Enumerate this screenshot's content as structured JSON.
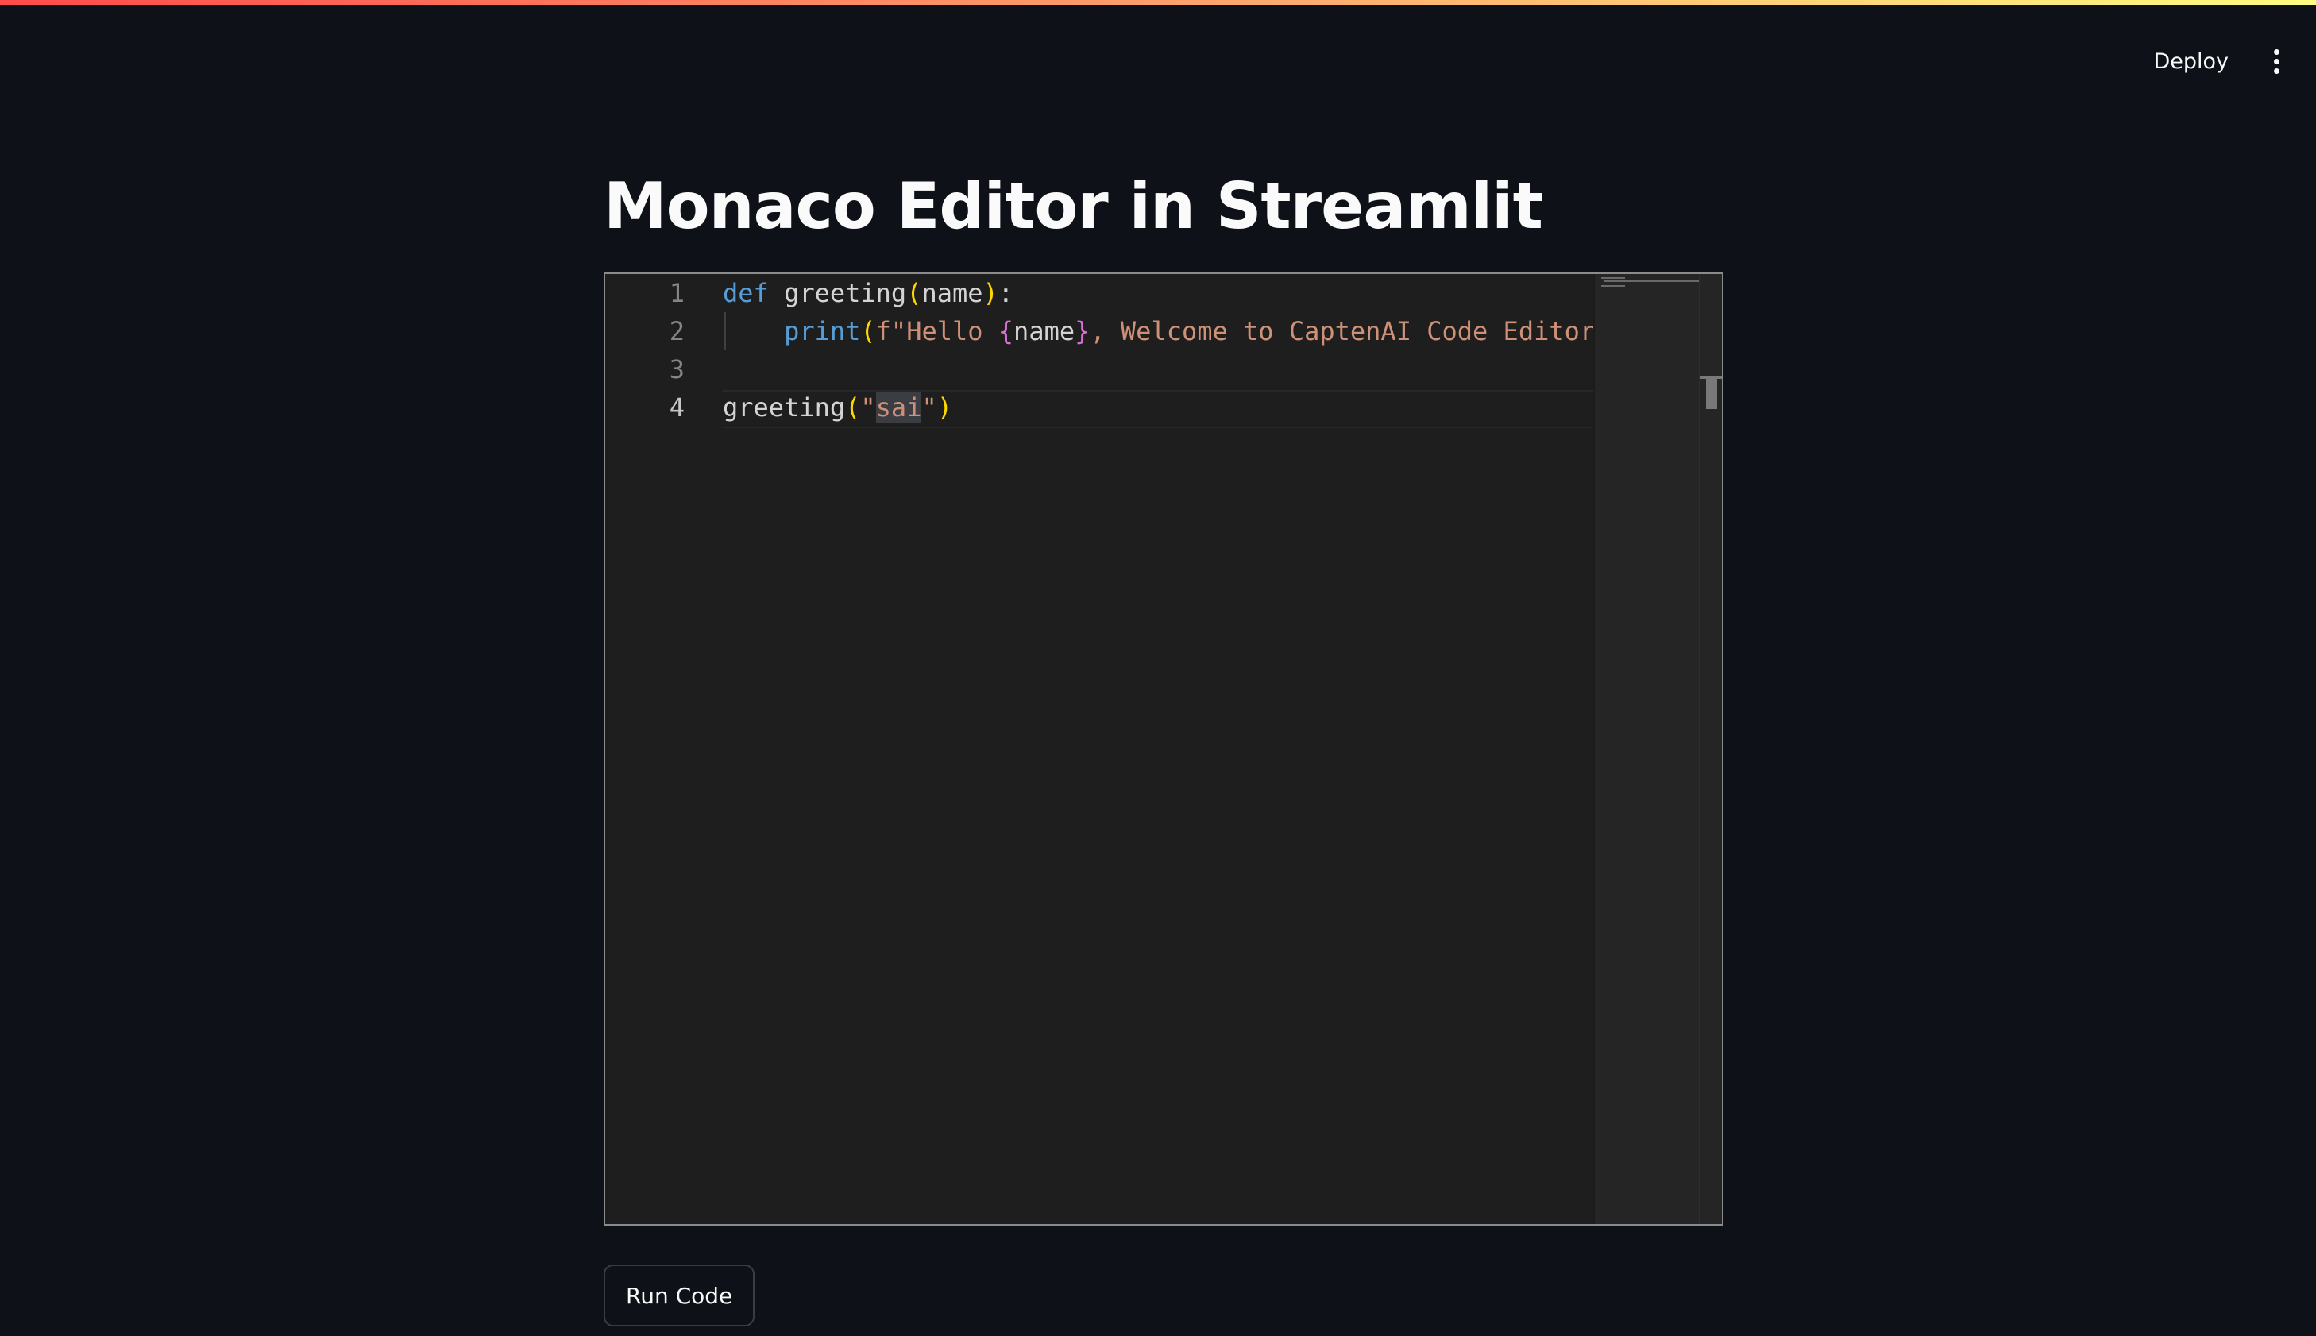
{
  "header": {
    "deploy_label": "Deploy",
    "menu_icon": "vertical-ellipsis-icon"
  },
  "main": {
    "title": "Monaco Editor in Streamlit",
    "run_button_label": "Run Code"
  },
  "editor": {
    "line_numbers": [
      "1",
      "2",
      "3",
      "4"
    ],
    "active_line": "4",
    "lines": [
      {
        "tokens": [
          {
            "text": "def",
            "kind": "kw"
          },
          {
            "text": " greeting",
            "kind": "id"
          },
          {
            "text": "(",
            "kind": "br1"
          },
          {
            "text": "name",
            "kind": "id"
          },
          {
            "text": ")",
            "kind": "br1"
          },
          {
            "text": ":",
            "kind": "id"
          }
        ]
      },
      {
        "tokens": [
          {
            "text": "    ",
            "kind": "id"
          },
          {
            "text": "print",
            "kind": "kw"
          },
          {
            "text": "(",
            "kind": "br1"
          },
          {
            "text": "f\"Hello ",
            "kind": "str"
          },
          {
            "text": "{",
            "kind": "br2"
          },
          {
            "text": "name",
            "kind": "id"
          },
          {
            "text": "}",
            "kind": "br2"
          },
          {
            "text": ", Welcome to CaptenAI Code Editor",
            "kind": "str"
          }
        ]
      },
      {
        "tokens": []
      },
      {
        "tokens": [
          {
            "text": "greeting",
            "kind": "id"
          },
          {
            "text": "(",
            "kind": "br1"
          },
          {
            "text": "\"",
            "kind": "str"
          },
          {
            "text": "sai",
            "kind": "str sel"
          },
          {
            "text": "\"",
            "kind": "str"
          },
          {
            "text": ")",
            "kind": "br1"
          }
        ]
      }
    ]
  },
  "colors": {
    "background": "#0e1117",
    "editor_background": "#1e1e1e",
    "keyword": "#569cd6",
    "string": "#ce9178",
    "bracket_level1": "#ffd700",
    "bracket_level2": "#da70d6"
  }
}
